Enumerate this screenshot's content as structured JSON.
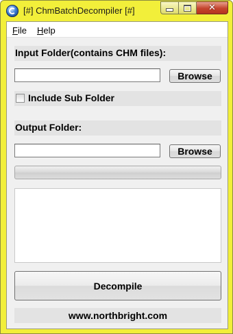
{
  "window": {
    "title": "[#] ChmBatchDecompiler [#]",
    "close_glyph": "✕",
    "frame_color": "#f2ef3a",
    "close_color": "#c4442e"
  },
  "menu": {
    "items": [
      "File",
      "Help"
    ]
  },
  "input": {
    "label": "Input Folder(contains CHM files):",
    "value": "",
    "browse_label": "Browse"
  },
  "include_sub": {
    "label": "Include Sub Folder",
    "checked": false
  },
  "output": {
    "label": "Output Folder:",
    "value": "",
    "browse_label": "Browse"
  },
  "progress": {
    "value": 0
  },
  "log": {
    "text": ""
  },
  "decompile_label": "Decompile",
  "footer": {
    "link": "www.northbright.com"
  }
}
